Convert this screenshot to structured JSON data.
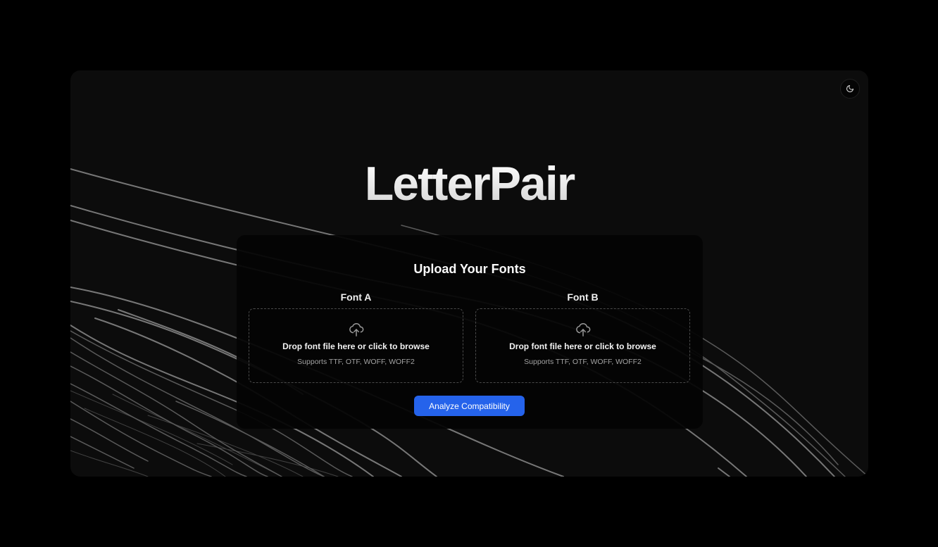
{
  "app": {
    "title": "LetterPair"
  },
  "theme_toggle": {
    "icon": "moon-icon"
  },
  "upload": {
    "heading": "Upload Your Fonts",
    "font_a": {
      "label": "Font A",
      "icon": "upload-cloud-icon",
      "drop_text": "Drop font file here or click to browse",
      "supports": "Supports TTF, OTF, WOFF, WOFF2"
    },
    "font_b": {
      "label": "Font B",
      "icon": "upload-cloud-icon",
      "drop_text": "Drop font file here or click to browse",
      "supports": "Supports TTF, OTF, WOFF, WOFF2"
    },
    "analyze_label": "Analyze Compatibility"
  },
  "colors": {
    "page_background": "#000000",
    "panel_background": "#0c0c0c",
    "accent": "#2563eb"
  }
}
